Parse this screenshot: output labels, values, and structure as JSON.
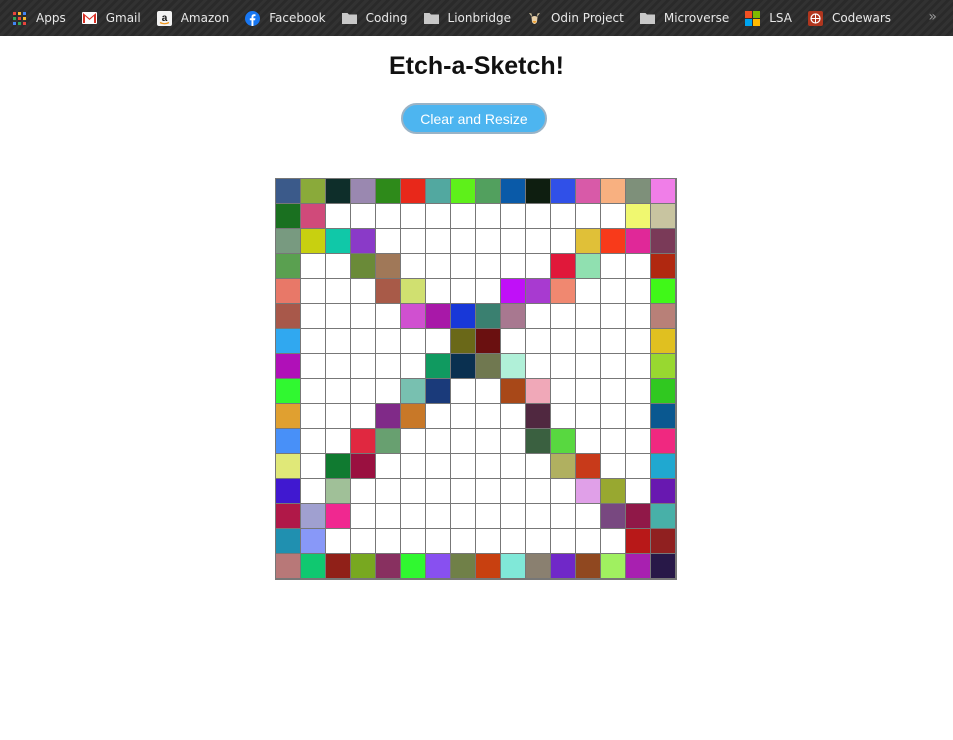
{
  "bookmarks": [
    {
      "label": "Apps",
      "icon": "apps-grid-icon"
    },
    {
      "label": "Gmail",
      "icon": "gmail-icon"
    },
    {
      "label": "Amazon",
      "icon": "amazon-icon"
    },
    {
      "label": "Facebook",
      "icon": "facebook-icon"
    },
    {
      "label": "Coding",
      "icon": "folder-icon"
    },
    {
      "label": "Lionbridge",
      "icon": "folder-icon"
    },
    {
      "label": "Odin Project",
      "icon": "odin-icon"
    },
    {
      "label": "Microverse",
      "icon": "folder-icon"
    },
    {
      "label": "LSA",
      "icon": "microsoft-icon"
    },
    {
      "label": "Codewars",
      "icon": "codewars-icon"
    }
  ],
  "overflow_label": "»",
  "page": {
    "title": "Etch-a-Sketch!",
    "button_label": "Clear and Resize"
  },
  "grid": {
    "size": 16,
    "default_color": "#ffffff",
    "cells": [
      [
        "#3b5a8a",
        "#8aaa3a",
        "#0e2e2a",
        "#9a88b0",
        "#2e8a1a",
        "#e8281a",
        "#52a8a0",
        "#5ef01a",
        "#52a05e",
        "#0a5aa8",
        "#0e1e10",
        "#3050e8",
        "#d85aa8",
        "#f8b080",
        "#7e907a",
        "#f07ee8"
      ],
      [
        "#1a7020",
        "#d04a7a",
        null,
        null,
        null,
        null,
        null,
        null,
        null,
        null,
        null,
        null,
        null,
        null,
        "#f0f870",
        "#c8c4a0"
      ],
      [
        "#789a80",
        "#c8d010",
        "#10c8a8",
        "#8a3ac8",
        null,
        null,
        null,
        null,
        null,
        null,
        null,
        null,
        "#e0c038",
        "#f83a1a",
        "#e02898",
        "#7a3a58"
      ],
      [
        "#5aa050",
        null,
        null,
        "#6a8a38",
        "#a07858",
        null,
        null,
        null,
        null,
        null,
        null,
        "#e0183a",
        "#90e0b0",
        null,
        null,
        "#b02810"
      ],
      [
        "#e87868",
        null,
        null,
        null,
        "#a85a48",
        "#d0e070",
        null,
        null,
        null,
        "#c010f8",
        "#a83ad0",
        "#f08870",
        null,
        null,
        null,
        "#40f818"
      ],
      [
        "#a8584a",
        null,
        null,
        null,
        null,
        "#d050d0",
        "#a818a8",
        "#1838d8",
        "#3a8070",
        "#a87890",
        null,
        null,
        null,
        null,
        null,
        "#b88078"
      ],
      [
        "#30a8f0",
        null,
        null,
        null,
        null,
        null,
        null,
        "#6a6818",
        "#6a1010",
        null,
        null,
        null,
        null,
        null,
        null,
        "#e0c020"
      ],
      [
        "#b010b8",
        null,
        null,
        null,
        null,
        null,
        "#109a60",
        "#0a3050",
        "#707850",
        "#b0f0d8",
        null,
        null,
        null,
        null,
        null,
        "#98d830"
      ],
      [
        "#30f830",
        null,
        null,
        null,
        null,
        "#78c0b0",
        "#1a3a7a",
        null,
        null,
        "#a84818",
        "#f0a8b8",
        null,
        null,
        null,
        null,
        "#30c820"
      ],
      [
        "#e0a030",
        null,
        null,
        null,
        "#802a88",
        "#c87828",
        null,
        null,
        null,
        null,
        "#502840",
        null,
        null,
        null,
        null,
        "#0a5890"
      ],
      [
        "#4890f8",
        null,
        null,
        "#e02840",
        "#68a070",
        null,
        null,
        null,
        null,
        null,
        "#3a6040",
        "#58d840",
        null,
        null,
        null,
        "#f02880"
      ],
      [
        "#e0e878",
        null,
        "#107a30",
        "#9a1040",
        null,
        null,
        null,
        null,
        null,
        null,
        null,
        "#b0b060",
        "#c83a1a",
        null,
        null,
        "#20a8d0"
      ],
      [
        "#4018d0",
        null,
        "#a0c098",
        null,
        null,
        null,
        null,
        null,
        null,
        null,
        null,
        null,
        "#e0a0e8",
        "#98a830",
        null,
        "#6818b0"
      ],
      [
        "#b01848",
        "#a0a0d0",
        "#f02890",
        null,
        null,
        null,
        null,
        null,
        null,
        null,
        null,
        null,
        null,
        "#784880",
        "#901848",
        "#48b0a8"
      ],
      [
        "#2090b0",
        "#8898f8",
        null,
        null,
        null,
        null,
        null,
        null,
        null,
        null,
        null,
        null,
        null,
        null,
        "#b81818",
        "#902020"
      ],
      [
        "#b87878",
        "#10c870",
        "#902018",
        "#78a820",
        "#883060",
        "#30f830",
        "#8850f0",
        "#708048",
        "#c84010",
        "#80e8d8",
        "#8a8070",
        "#7028c8",
        "#904820",
        "#a0f060",
        "#a820b0",
        "#281848"
      ]
    ]
  }
}
